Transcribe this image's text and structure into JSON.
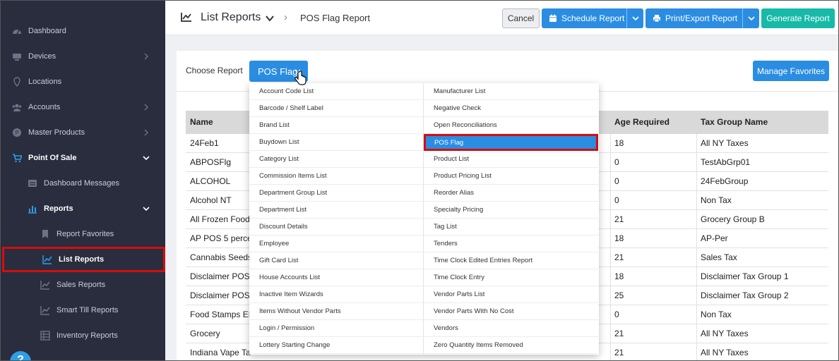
{
  "sidebar": {
    "items": [
      {
        "label": "Dashboard",
        "icon": "dashboard-icon"
      },
      {
        "label": "Devices",
        "icon": "devices-icon"
      },
      {
        "label": "Locations",
        "icon": "location-pin-icon"
      },
      {
        "label": "Accounts",
        "icon": "users-icon"
      },
      {
        "label": "Master Products",
        "icon": "product-icon"
      },
      {
        "label": "Point Of Sale",
        "icon": "cart-icon"
      },
      {
        "label": "Dashboard Messages",
        "icon": "message-icon"
      },
      {
        "label": "Reports",
        "icon": "bar-chart-icon"
      },
      {
        "label": "Report Favorites",
        "icon": "bookmark-icon"
      },
      {
        "label": "List Reports",
        "icon": "line-chart-icon"
      },
      {
        "label": "Sales Reports",
        "icon": "line-chart-icon"
      },
      {
        "label": "Smart Till Reports",
        "icon": "line-chart-icon"
      },
      {
        "label": "Inventory Reports",
        "icon": "inventory-icon"
      }
    ]
  },
  "header": {
    "title": "List Reports",
    "breadcrumb_sep": "›",
    "breadcrumb": "POS Flag Report",
    "cancel": "Cancel",
    "schedule": "Schedule Report",
    "print": "Print/Export Report",
    "generate": "Generate Report"
  },
  "controls": {
    "choose_label": "Choose Report",
    "selected_report": "POS Flag",
    "manage_favorites": "Manage Favorites"
  },
  "menu": {
    "left": [
      "Account Code List",
      "Barcode / Shelf Label",
      "Brand List",
      "Buydown List",
      "Category List",
      "Commission Items List",
      "Department Group List",
      "Department List",
      "Discount Details",
      "Employee",
      "Gift Card List",
      "House Accounts List",
      "Inactive Item Wizards",
      "Items Without Vendor Parts",
      "Login / Permission",
      "Lottery Starting Change"
    ],
    "right": [
      "Manufacturer List",
      "Negative Check",
      "Open Reconciliations",
      "POS Flag",
      "Product List",
      "Product Pricing List",
      "Reorder Alias",
      "Specialty Pricing",
      "Tag List",
      "Tenders",
      "Time Clock Edited Entries Report",
      "Time Clock Entry",
      "Vendor Parts List",
      "Vendor Parts With No Cost",
      "Vendors",
      "Zero Quantity Items Removed"
    ],
    "active": "POS Flag"
  },
  "table": {
    "headers": {
      "name": "Name",
      "age": "Age Required",
      "tax": "Tax Group Name"
    },
    "rows": [
      {
        "name": "24Feb1",
        "age": "18",
        "tax": "All NY Taxes"
      },
      {
        "name": "ABPOSFlg",
        "age": "0",
        "tax": "TestAbGrp01"
      },
      {
        "name": "ALCOHOL",
        "age": "0",
        "tax": "24FebGroup"
      },
      {
        "name": "Alcohol NT",
        "age": "0",
        "tax": "Non Tax"
      },
      {
        "name": "All Frozen Food",
        "age": "21",
        "tax": "Grocery Group B"
      },
      {
        "name": "AP POS 5 perce",
        "age": "18",
        "tax": "AP-Per"
      },
      {
        "name": "Cannabis Seeds",
        "age": "21",
        "tax": "Sales Tax"
      },
      {
        "name": "Disclaimer POS",
        "age": "18",
        "tax": "Disclaimer Tax Group 1"
      },
      {
        "name": "Disclaimer POS",
        "age": "25",
        "tax": "Disclaimer Tax Group 2"
      },
      {
        "name": "Food Stamps EE",
        "age": "0",
        "tax": "Non Tax"
      },
      {
        "name": "Grocery",
        "age": "21",
        "tax": "All NY Taxes"
      },
      {
        "name": "Indiana Vape Ta",
        "age": "21",
        "tax": "All NY Taxes"
      }
    ]
  },
  "colors": {
    "sidebar_bg": "#2a2d3e",
    "primary": "#2a8de2",
    "teal": "#17b9a7",
    "highlight": "#d60d0d"
  }
}
